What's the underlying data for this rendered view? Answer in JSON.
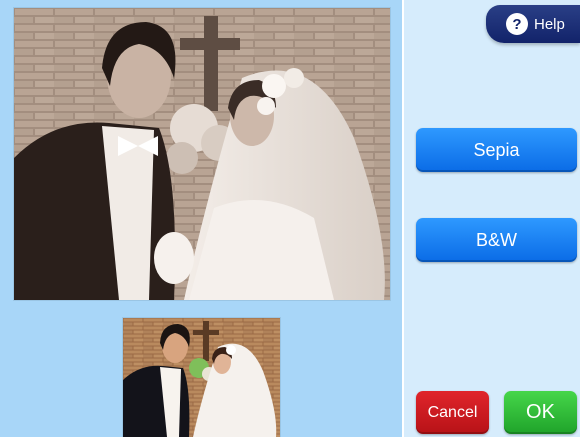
{
  "help": {
    "label": "Help",
    "icon": "question-icon"
  },
  "effects": {
    "sepia_label": "Sepia",
    "bw_label": "B&W"
  },
  "actions": {
    "cancel_label": "Cancel",
    "ok_label": "OK"
  },
  "preview": {
    "applied_effect": "sepia",
    "original": "color"
  },
  "colors": {
    "left_pane": "#a8d6f8",
    "right_pane": "#d6ecfc",
    "help_tab": "#12236a",
    "effect_button": "#0a6be6",
    "cancel_button": "#c4161c",
    "ok_button": "#2bb235"
  }
}
